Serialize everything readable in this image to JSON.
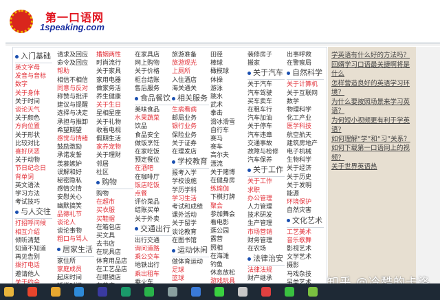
{
  "header": {
    "logo_cn": "第一口语网",
    "logo_en": "1speaking.com"
  },
  "columns": [
    [
      {
        "h": "入门基础"
      },
      {
        "t": "英文字母",
        "r": 1
      },
      {
        "t": "发音与音标",
        "r": 1
      },
      {
        "t": "数字",
        "r": 1
      },
      {
        "t": "关于身体",
        "r": 1
      },
      {
        "t": "关于时间"
      },
      {
        "t": "谈论天气",
        "r": 1
      },
      {
        "t": "关于颜色"
      },
      {
        "t": "方向位置",
        "r": 1
      },
      {
        "t": "关于形状"
      },
      {
        "t": "比较对比"
      },
      {
        "t": "喜好厌恶",
        "r": 1
      },
      {
        "t": "关于动物"
      },
      {
        "t": "节日纪念日",
        "r": 1
      },
      {
        "t": "背单词",
        "r": 1
      },
      {
        "t": "英文语法"
      },
      {
        "t": "学习方法"
      },
      {
        "t": "考试技巧"
      },
      {
        "h": "与人交往"
      },
      {
        "t": "打招呼问候",
        "r": 1
      },
      {
        "t": "相互介绍",
        "r": 1
      },
      {
        "t": "倾听清楚"
      },
      {
        "t": "知道不知道"
      },
      {
        "t": "再见告别"
      },
      {
        "t": "拨打电话",
        "r": 1
      },
      {
        "t": "邀请他人"
      },
      {
        "t": "关于约会",
        "r": 1
      }
    ],
    [
      {
        "t": "请求及回应"
      },
      {
        "t": "命令及回应"
      },
      {
        "t": "帮助",
        "r": 1
      },
      {
        "t": "相信不相信"
      },
      {
        "t": "同意与反对",
        "r": 1
      },
      {
        "t": "称赞与批评"
      },
      {
        "t": "建议与提醒"
      },
      {
        "t": "选择与决定"
      },
      {
        "t": "承担与推卸"
      },
      {
        "t": "希望期望"
      },
      {
        "t": "感觉与情绪",
        "r": 1
      },
      {
        "t": "鼓励激励"
      },
      {
        "t": "承诺发誓"
      },
      {
        "t": "羡慕嫉妒"
      },
      {
        "t": "误解和好"
      },
      {
        "t": "秘密隐私"
      },
      {
        "t": "感情交情"
      },
      {
        "t": "安慰关心"
      },
      {
        "t": "幽默搞笑"
      },
      {
        "t": "品德礼节",
        "r": 1
      },
      {
        "t": "谈论人",
        "r": 1
      },
      {
        "t": "谈论事物"
      },
      {
        "t": "粗口与骂人",
        "r": 1
      },
      {
        "h": "居家生活"
      },
      {
        "t": "家住所"
      },
      {
        "t": "家庭成员",
        "r": 1
      },
      {
        "t": "起床时间"
      },
      {
        "t": "睡觉时间"
      }
    ],
    [
      {
        "t": "婚姻两性",
        "r": 1
      },
      {
        "t": "时尚流行"
      },
      {
        "t": "关于家具"
      },
      {
        "t": "家用电器"
      },
      {
        "t": "做家务活"
      },
      {
        "t": "养生健康"
      },
      {
        "t": "关于生日",
        "r": 1
      },
      {
        "t": "星相星座"
      },
      {
        "t": "关于礼物"
      },
      {
        "t": "收看电视"
      },
      {
        "t": "假期生活"
      },
      {
        "t": "家养宠物",
        "r": 1
      },
      {
        "t": "关于理财"
      },
      {
        "t": "邻居"
      },
      {
        "t": "社区"
      },
      {
        "h": "购物"
      },
      {
        "t": "购物"
      },
      {
        "t": "在超市",
        "r": 1
      },
      {
        "t": "买衣服",
        "r": 1
      },
      {
        "t": "买鞋帽",
        "r": 1
      },
      {
        "t": "在箱包店"
      },
      {
        "t": "买文具"
      },
      {
        "t": "去书店"
      },
      {
        "t": "在玩具店"
      },
      {
        "t": "体育用品店"
      },
      {
        "t": "在工艺品店"
      },
      {
        "t": "在眼镜店"
      },
      {
        "t": "在花店"
      }
    ],
    [
      {
        "t": "在家具店"
      },
      {
        "t": "网上购物"
      },
      {
        "t": "关于价格"
      },
      {
        "t": "柜台结账"
      },
      {
        "t": "售后服务"
      },
      {
        "h": "食品餐饮"
      },
      {
        "t": "美味食品"
      },
      {
        "t": "水果蔬菜",
        "r": 1
      },
      {
        "t": "饮品"
      },
      {
        "t": "食品安全"
      },
      {
        "t": "做饭烹饪"
      },
      {
        "t": "在家吃饭"
      },
      {
        "t": "预定餐位"
      },
      {
        "t": "在酒吧",
        "r": 1
      },
      {
        "t": "在咖啡厅"
      },
      {
        "t": "饭店吃饭",
        "r": 1
      },
      {
        "t": "点餐",
        "r": 1
      },
      {
        "t": "评价菜品"
      },
      {
        "t": "结账买单"
      },
      {
        "t": "关于外卖"
      },
      {
        "h": "交通出行"
      },
      {
        "t": "出行交通"
      },
      {
        "t": "询问道路",
        "r": 1
      },
      {
        "t": "乘公交车",
        "r": 1
      },
      {
        "t": "地铁出行"
      },
      {
        "t": "乘出租车",
        "r": 1
      },
      {
        "t": "乘火车"
      },
      {
        "t": "乘飞机",
        "r": 1
      }
    ],
    [
      {
        "t": "旅游准备"
      },
      {
        "t": "旅游观光",
        "r": 1
      },
      {
        "t": "上厕所",
        "r": 1
      },
      {
        "t": "入住酒店"
      },
      {
        "t": "海关通关"
      },
      {
        "h": "相关服务"
      },
      {
        "t": "生病看病",
        "r": 1
      },
      {
        "t": "邮局业务"
      },
      {
        "t": "银行业务",
        "r": 1
      },
      {
        "t": "保险业务"
      },
      {
        "t": "关于证券"
      },
      {
        "t": "在理发店"
      },
      {
        "h": "学校教育"
      },
      {
        "t": "报考入学"
      },
      {
        "t": "学校设施"
      },
      {
        "t": "学历学科"
      },
      {
        "t": "学习生活",
        "r": 1
      },
      {
        "t": "考试和成绩"
      },
      {
        "t": "课外活动"
      },
      {
        "t": "关于留学"
      },
      {
        "t": "谈论教育"
      },
      {
        "t": "在图书馆"
      },
      {
        "h": "运动休闲"
      },
      {
        "t": "做体育运动"
      },
      {
        "t": "足球",
        "r": 1
      },
      {
        "t": "篮球",
        "r": 1
      },
      {
        "t": "排球"
      }
    ],
    [
      {
        "t": "田径"
      },
      {
        "t": "棒球"
      },
      {
        "t": "橄榄球"
      },
      {
        "t": "体操"
      },
      {
        "t": "游泳"
      },
      {
        "t": "跳水"
      },
      {
        "t": "武术"
      },
      {
        "t": "拳击"
      },
      {
        "t": "滑冰滑雪"
      },
      {
        "t": "自行车"
      },
      {
        "t": "赛马"
      },
      {
        "t": "赛车"
      },
      {
        "t": "高尔夫"
      },
      {
        "t": "漂流"
      },
      {
        "t": "关于赌博"
      },
      {
        "t": "在健身房"
      },
      {
        "t": "练瑜伽",
        "r": 1
      },
      {
        "t": "下棋打牌"
      },
      {
        "t": "聚会",
        "r": 1
      },
      {
        "t": "参加舞会"
      },
      {
        "t": "看电影"
      },
      {
        "t": "逛公园"
      },
      {
        "t": "露营"
      },
      {
        "t": "照相"
      },
      {
        "t": "在海滩"
      },
      {
        "t": "钓鱼"
      },
      {
        "t": "休息放松"
      },
      {
        "t": "游戏玩具",
        "r": 1
      }
    ],
    [
      {
        "t": "装修房子"
      },
      {
        "t": "搬家"
      },
      {
        "h": "关于汽车"
      },
      {
        "t": "关于汽车"
      },
      {
        "t": "汽车驾驶"
      },
      {
        "t": "买车卖车"
      },
      {
        "t": "在租车行"
      },
      {
        "t": "汽车加油"
      },
      {
        "t": "关于停车"
      },
      {
        "t": "汽车违章"
      },
      {
        "t": "交通事故"
      },
      {
        "t": "故障与检修"
      },
      {
        "t": "汽车保养"
      },
      {
        "h": "关于工作"
      },
      {
        "t": "关于工作",
        "r": 1
      },
      {
        "t": "求职",
        "r": 1
      },
      {
        "t": "办公管理",
        "r": 1
      },
      {
        "t": "人力管理"
      },
      {
        "t": "技术研发"
      },
      {
        "t": "生产管理"
      },
      {
        "t": "市场营销",
        "r": 1
      },
      {
        "t": "财务管理"
      },
      {
        "t": "在农场"
      },
      {
        "h": "法律治安"
      },
      {
        "t": "法律法规",
        "r": 1
      },
      {
        "t": "财产继承"
      },
      {
        "t": "标识和警告"
      }
    ],
    [
      {
        "t": "出事呼救"
      },
      {
        "t": "在警察局"
      },
      {
        "h": "自然科学"
      },
      {
        "t": "关于计算机",
        "r": 1
      },
      {
        "t": "关于互联网"
      },
      {
        "t": "数学"
      },
      {
        "t": "物理科学"
      },
      {
        "t": "化工产业"
      },
      {
        "t": "医学科技",
        "r": 1
      },
      {
        "t": "航空航天"
      },
      {
        "t": "建筑房地产"
      },
      {
        "t": "电子机械"
      },
      {
        "t": "生物科学"
      },
      {
        "t": "关于经济"
      },
      {
        "t": "关于历史"
      },
      {
        "t": "关于发明"
      },
      {
        "t": "能源"
      },
      {
        "t": "环境保护",
        "r": 1
      },
      {
        "t": "自然灾害"
      },
      {
        "h": "文化艺术"
      },
      {
        "t": "工艺美术",
        "r": 1
      },
      {
        "t": "音乐歌舞",
        "r": 1
      },
      {
        "t": "影视艺术"
      },
      {
        "t": "文学艺术"
      },
      {
        "t": "摄影"
      },
      {
        "t": "马戏杂技"
      },
      {
        "t": "另类艺术"
      }
    ]
  ],
  "sidebar": {
    "links": [
      "学英语有什么好的方法吗？",
      "回婿学习口语最关捷啊将是什么",
      "怎样营造良好的英语学习环境？",
      "为什么要按照场景来学习英语？",
      "为何短小视频更有利于学英语?",
      "如何理解“学”和“习”关系？",
      "如何下载第一口语网上的视频？",
      "关于世界英语热"
    ]
  },
  "watermark": "知乎 @冷酷的卡洛",
  "taskbar": {
    "icons": [
      "file-explorer-icon",
      "red-app-icon",
      "shield-app-icon",
      "edge-browser-icon",
      "quote-app-icon",
      "u-app-icon",
      "green-leaf-app-icon",
      "mountain-app-icon",
      "qbittorrent-icon",
      "green-arrow-app-icon",
      "monitor-app-icon",
      "red-window-app-icon",
      "wechat-icon",
      "clover-app-icon"
    ],
    "colors": [
      "#e8b43c",
      "#e8452c",
      "#e8a830",
      "#2e8ad8",
      "#3a3aa0",
      "#1a9a6a",
      "#29b34a",
      "#8aa0a0",
      "#3a7ad8",
      "#3ad040",
      "#c8c8c8",
      "#e04040",
      "#3ac040",
      "#7ac040"
    ]
  }
}
